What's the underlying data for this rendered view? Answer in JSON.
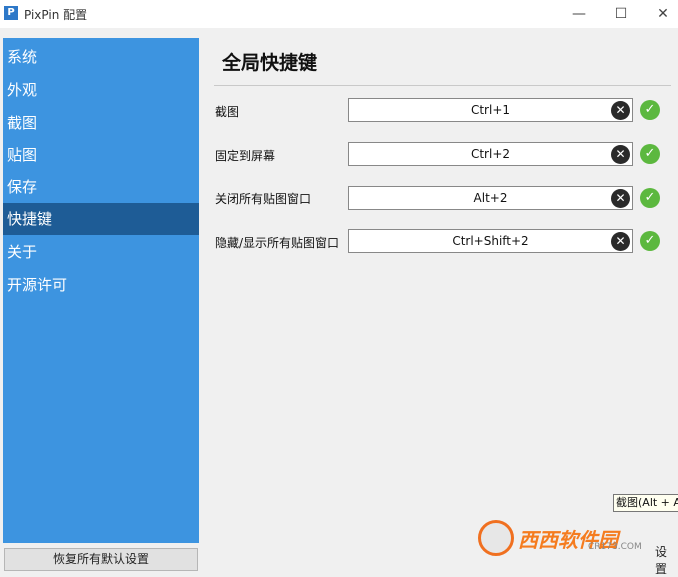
{
  "window": {
    "title": "PixPin 配置",
    "icon_label": "P",
    "minimize_icon": "minimize-icon",
    "maximize_icon": "maximize-icon",
    "close_icon": "close-icon"
  },
  "sidebar": {
    "items": [
      {
        "label": "系统"
      },
      {
        "label": "外观"
      },
      {
        "label": "截图"
      },
      {
        "label": "贴图"
      },
      {
        "label": "保存"
      },
      {
        "label": "快捷键",
        "active": true
      },
      {
        "label": "关于"
      },
      {
        "label": "开源许可"
      }
    ],
    "reset_button": "恢复所有默认设置"
  },
  "main": {
    "title": "全局快捷键",
    "shortcuts": [
      {
        "label": "截图",
        "value": "Ctrl+1"
      },
      {
        "label": "固定到屏幕",
        "value": "Ctrl+2"
      },
      {
        "label": "关闭所有贴图窗口",
        "value": "Alt+2"
      },
      {
        "label": "隐藏/显示所有贴图窗口",
        "value": "Ctrl+Shift+2"
      }
    ],
    "tooltip": "截图(Alt + A",
    "partial_button": "设置"
  },
  "watermark": {
    "text": "西西软件园",
    "sub": "CR173.COM"
  },
  "colors": {
    "sidebar": "#3d94e0",
    "sidebar_active": "#1e5c96",
    "check_green": "#5cb83f"
  }
}
